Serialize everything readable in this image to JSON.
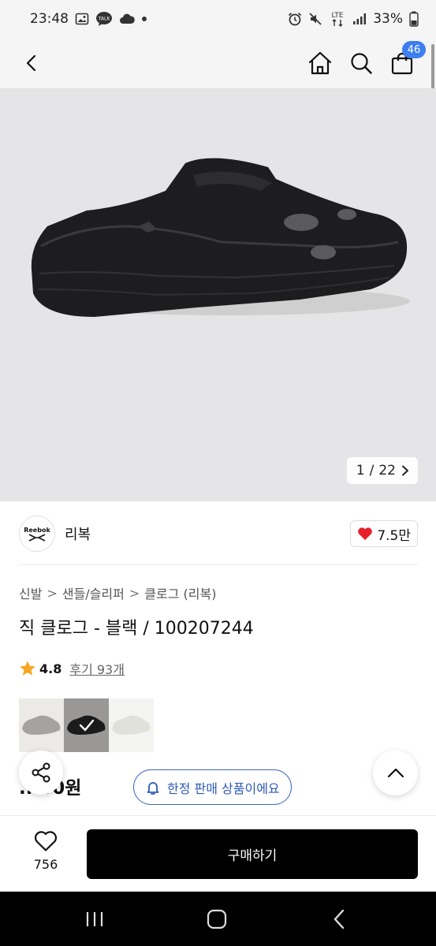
{
  "status_bar": {
    "time": "23:48",
    "talk_label": "TALK",
    "lte_label": "LTE",
    "battery": "33%"
  },
  "nav": {
    "cart_count": "46",
    "icons": [
      "back-icon",
      "home-icon",
      "search-icon",
      "cart-icon"
    ]
  },
  "gallery": {
    "current": "1",
    "separator": "/",
    "total": "22"
  },
  "brand": {
    "logo_text": "Reebok",
    "name": "리복",
    "likes": "7.5만"
  },
  "breadcrumb": {
    "items": [
      "신발",
      "샌들/슬리퍼",
      "클로그 (리복)"
    ],
    "separator": ">"
  },
  "product": {
    "title": "직 클로그 - 블랙 / 100207244",
    "rating": "4.8",
    "reviews": "후기 93개",
    "price": "...00원"
  },
  "swatches": {
    "colors": [
      "#a5a29f",
      "#2a2a2a",
      "#e9e9e4"
    ],
    "selected": 1
  },
  "limited": {
    "label": "한정 판매 상품이에요"
  },
  "bottom_bar": {
    "wish_count": "756",
    "buy_label": "구매하기"
  },
  "theme": {
    "accent": "#3d7ff0",
    "limited_color": "#2e58b8",
    "heart_color": "#e8202a",
    "star_color": "#f5a623"
  }
}
